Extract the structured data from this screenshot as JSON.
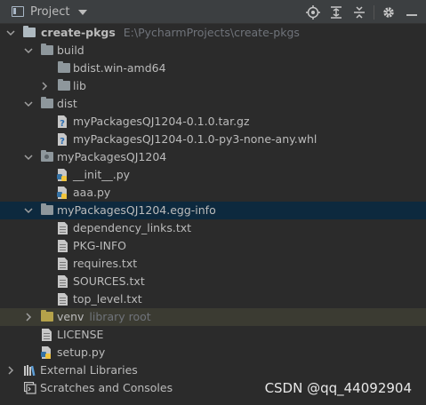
{
  "header": {
    "title": "Project",
    "tools": [
      "locate-icon",
      "expand-all-icon",
      "collapse-all-icon",
      "settings-icon",
      "hide-icon"
    ]
  },
  "tree": [
    {
      "label": "create-pkgs",
      "hint": "E:\\PycharmProjects\\create-pkgs",
      "icon": "folder",
      "expanded": true
    },
    {
      "label": "build",
      "icon": "folder",
      "expanded": true
    },
    {
      "label": "bdist.win-amd64",
      "icon": "folder"
    },
    {
      "label": "lib",
      "icon": "folder",
      "expanded": false
    },
    {
      "label": "dist",
      "icon": "folder",
      "expanded": true
    },
    {
      "label": "myPackagesQJ1204-0.1.0.tar.gz",
      "icon": "unknown-file"
    },
    {
      "label": "myPackagesQJ1204-0.1.0-py3-none-any.whl",
      "icon": "unknown-file"
    },
    {
      "label": "myPackagesQJ1204",
      "icon": "package-folder",
      "expanded": true
    },
    {
      "label": "__init__.py",
      "icon": "python-file"
    },
    {
      "label": "aaa.py",
      "icon": "python-file"
    },
    {
      "label": "myPackagesQJ1204.egg-info",
      "icon": "folder",
      "expanded": true,
      "selected": true
    },
    {
      "label": "dependency_links.txt",
      "icon": "text-file"
    },
    {
      "label": "PKG-INFO",
      "icon": "text-file"
    },
    {
      "label": "requires.txt",
      "icon": "text-file"
    },
    {
      "label": "SOURCES.txt",
      "icon": "text-file"
    },
    {
      "label": "top_level.txt",
      "icon": "text-file"
    },
    {
      "label": "venv",
      "hint": "library root",
      "icon": "venv-folder",
      "expanded": false
    },
    {
      "label": "LICENSE",
      "icon": "text-file"
    },
    {
      "label": "setup.py",
      "icon": "python-file"
    },
    {
      "label": "External Libraries",
      "icon": "libraries",
      "expanded": false
    },
    {
      "label": "Scratches and Consoles",
      "icon": "scratches"
    }
  ],
  "watermark": "CSDN @qq_44092904"
}
